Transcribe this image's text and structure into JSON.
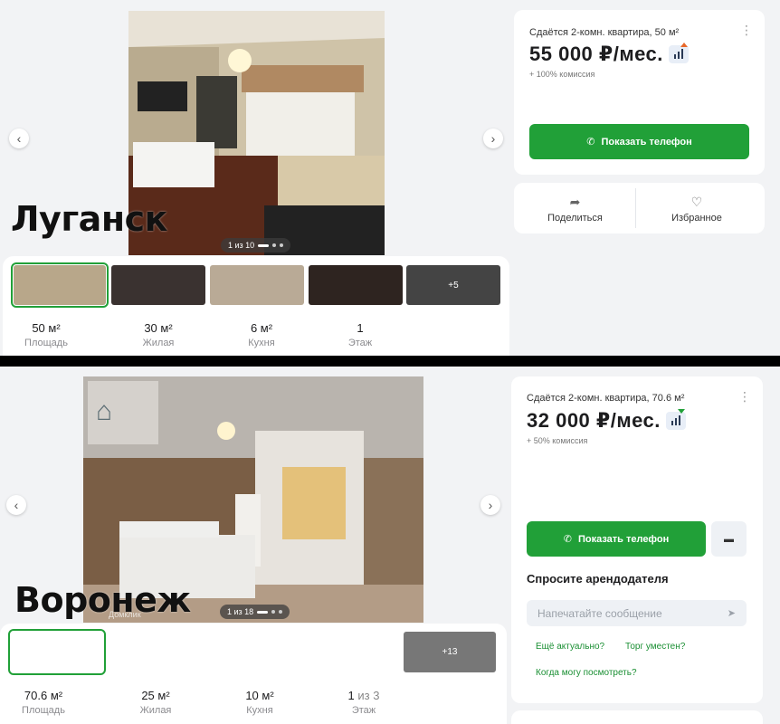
{
  "top": {
    "city": "Луганск",
    "counter": "1 из 10",
    "more_thumbs": "+5",
    "stats": [
      {
        "value": "50 м²",
        "label": "Площадь"
      },
      {
        "value": "30 м²",
        "label": "Жилая"
      },
      {
        "value": "6 м²",
        "label": "Кухня"
      },
      {
        "value": "1",
        "label": "Этаж"
      }
    ],
    "subtitle": "Сдаётся 2-комн. квартира, 50 м²",
    "price": "55 000 ₽/мес.",
    "fee": "+ 100% комиссия",
    "show_phone": "Показать телефон",
    "share": "Поделиться",
    "favorite": "Избранное"
  },
  "bottom": {
    "city": "Воронеж",
    "counter": "1 из 18",
    "watermark": "Домклик",
    "more_thumbs": "+13",
    "stats": [
      {
        "value": "70.6 м²",
        "extra": "",
        "label": "Площадь"
      },
      {
        "value": "25 м²",
        "extra": "",
        "label": "Жилая"
      },
      {
        "value": "10 м²",
        "extra": "",
        "label": "Кухня"
      },
      {
        "value": "1",
        "extra": " из 3",
        "label": "Этаж"
      }
    ],
    "subtitle": "Сдаётся 2-комн. квартира, 70.6 м²",
    "price": "32 000 ₽/мес.",
    "fee": "+ 50% комиссия",
    "show_phone": "Показать телефон",
    "ask_title": "Спросите арендодателя",
    "message_placeholder": "Напечатайте сообщение",
    "chips": [
      "Ещё актуально?",
      "Торг уместен?",
      "Когда могу посмотреть?"
    ]
  },
  "icons": {
    "prev": "chevron-left-icon",
    "next": "chevron-right-icon",
    "phone": "phone-icon",
    "share": "share-icon",
    "heart": "heart-icon",
    "send": "send-icon",
    "chat": "chat-icon"
  },
  "colors": {
    "accent": "#21a038",
    "background": "#f2f3f5"
  }
}
